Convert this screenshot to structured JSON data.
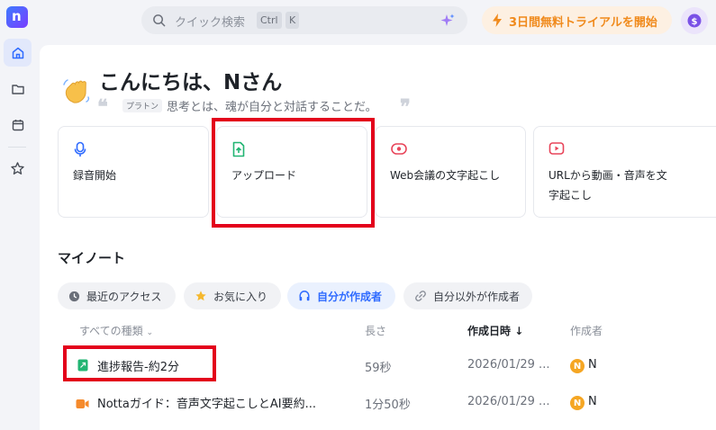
{
  "app": {
    "logo_letter": "n"
  },
  "search": {
    "placeholder": "クイック検索",
    "kbd1": "Ctrl",
    "kbd2": "K"
  },
  "trial": {
    "label": "3日間無料トライアルを開始"
  },
  "greeting": {
    "title": "こんにちは、Nさん",
    "quote_author": "プラトン",
    "quote": "思考とは、魂が自分と対話することだ。"
  },
  "actions": [
    {
      "label": "録音開始",
      "icon": "microphone-icon"
    },
    {
      "label": "アップロード",
      "icon": "upload-icon"
    },
    {
      "label": "Web会議の文字起こし",
      "icon": "meeting-icon"
    },
    {
      "label_line1": "URLから動画・音声を文",
      "label_line2": "字起こし",
      "icon": "video-icon"
    }
  ],
  "notes": {
    "title": "マイノート",
    "filters": [
      {
        "label": "最近のアクセス",
        "icon": "clock-icon"
      },
      {
        "label": "お気に入り",
        "icon": "star-icon"
      },
      {
        "label": "自分が作成者",
        "icon": "headphones-icon"
      },
      {
        "label": "自分以外が作成者",
        "icon": "link-icon"
      }
    ],
    "columns": {
      "type": "すべての種類",
      "length": "長さ",
      "created": "作成日時",
      "creator": "作成者"
    },
    "rows": [
      {
        "title": "進捗報告-約2分",
        "length": "59秒",
        "date": "2026/01/29 ...",
        "creator": "N",
        "avatar": "N"
      },
      {
        "title": "Nottaガイド：音声文字起こしとAI要約...",
        "length": "1分50秒",
        "date": "2026/01/29 ...",
        "creator": "N",
        "avatar": "N"
      }
    ]
  },
  "colors": {
    "accent": "#2f6bff",
    "highlight": "#e3001b",
    "trial": "#f08a1c"
  }
}
